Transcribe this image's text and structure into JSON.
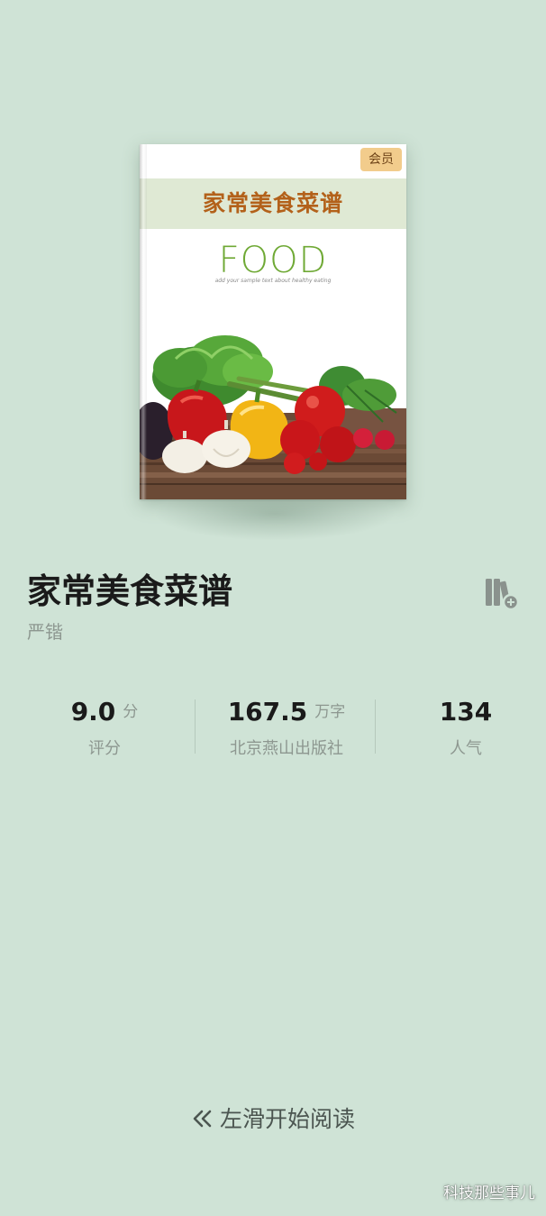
{
  "book": {
    "cover_badge": "会员",
    "cover_title": "家常美食菜谱",
    "cover_word": "FOOD",
    "cover_tagline": "add your sample text about healthy eating",
    "title": "家常美食菜谱",
    "author": "严锴",
    "shelf_icon": "add-to-bookshelf-icon"
  },
  "stats": [
    {
      "value": "9.0",
      "unit": "分",
      "label": "评分"
    },
    {
      "value": "167.5",
      "unit": "万字",
      "label": "北京燕山出版社"
    },
    {
      "value": "134",
      "unit": "",
      "label": "人气"
    }
  ],
  "swipe_hint": "左滑开始阅读",
  "watermark": "科技那些事儿",
  "colors": {
    "background": "#cfe3d6",
    "vip_badge": "#f2cc8c",
    "cover_title": "#b3611a",
    "food_word": "#6fa935"
  }
}
